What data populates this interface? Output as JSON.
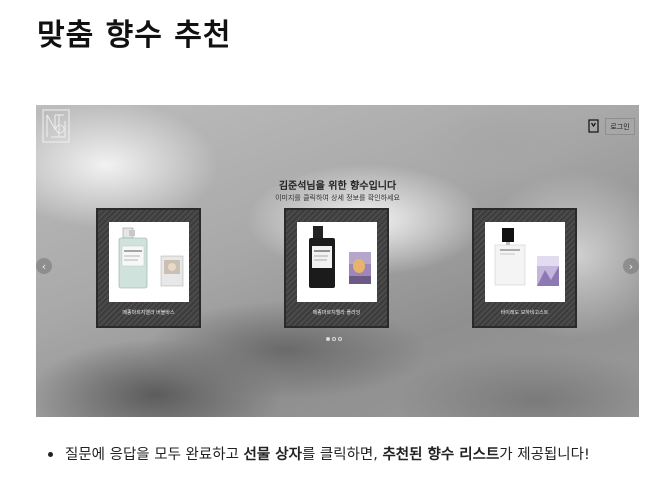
{
  "page": {
    "title": "맞춤 향수 추천"
  },
  "screenshot": {
    "logo_caption": "",
    "header": {
      "login_label": "로그인",
      "bookmark_icon": "bookmark-icon"
    },
    "headline": "김준석님을 위한 향수입니다",
    "subline": "이미지를 클릭하여 상세 정보를 확인하세요",
    "cards": [
      {
        "label": "메종마르지엘라 버블바스",
        "bottle": "clear-green"
      },
      {
        "label": "메종마르지엘라 플라잉",
        "bottle": "black"
      },
      {
        "label": "바이레도 모하비고스트",
        "bottle": "white-byredo"
      }
    ],
    "nav": {
      "prev_label": "‹",
      "next_label": "›"
    },
    "pagination": {
      "count": 3,
      "active_index": 0
    }
  },
  "note": {
    "part1": "질문에 응답을 모두 완료하고 ",
    "bold1": "선물 상자",
    "part2": "를 클릭하면, ",
    "bold2": "추천된 향수 리스트",
    "part3": "가 제공됩니다!"
  }
}
